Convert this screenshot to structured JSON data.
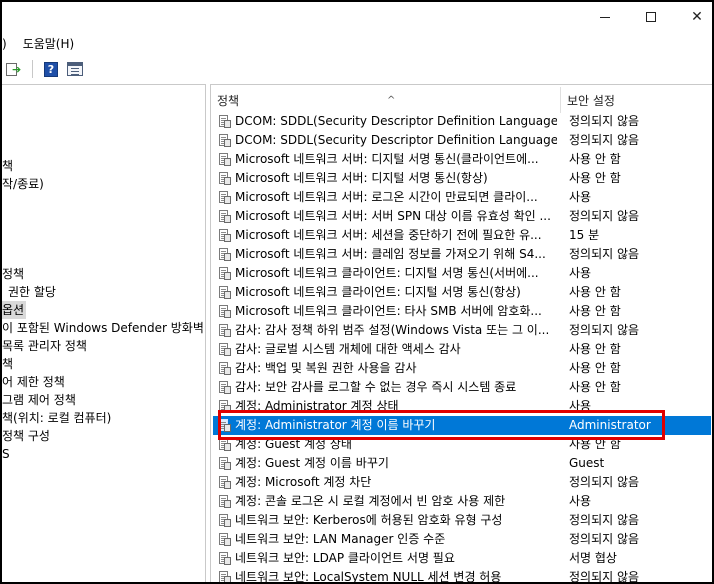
{
  "window": {
    "minimize_glyph": "",
    "close_glyph": "✕"
  },
  "menu": {
    "items": [
      {
        "label": ")"
      },
      {
        "label": "도움말(H)"
      }
    ]
  },
  "toolbar": {
    "buttons": [
      {
        "icon": "export-list-icon"
      },
      {
        "icon": "help-icon",
        "label": "?"
      },
      {
        "icon": "properties-icon"
      }
    ]
  },
  "tree": {
    "items": [
      {
        "label": "책"
      },
      {
        "label": "작/종료)"
      },
      {
        "label": "정책"
      },
      {
        "label": "권한 할당"
      },
      {
        "label": "옵션"
      },
      {
        "label": "이 포함된 Windows Defender 방화벽"
      },
      {
        "label": "목록 관리자 정책"
      },
      {
        "label": "책"
      },
      {
        "label": "어 제한 정책"
      },
      {
        "label": "그램 제어 정책"
      },
      {
        "label": "책(위치: 로컬 컴퓨터)"
      },
      {
        "label": "정책 구성"
      },
      {
        "label": "S"
      }
    ]
  },
  "table": {
    "columns": {
      "policy": "정책",
      "setting": "보안 설정"
    },
    "sort_caret": "^",
    "rows": [
      {
        "policy": "DCOM: SDDL(Security Descriptor Definition Language) 구...",
        "setting": "정의되지 않음"
      },
      {
        "policy": "DCOM: SDDL(Security Descriptor Definition Language) 구...",
        "setting": "정의되지 않음"
      },
      {
        "policy": "Microsoft 네트워크 서버: 디지털 서명 통신(클라이언트에...",
        "setting": "사용 안 함"
      },
      {
        "policy": "Microsoft 네트워크 서버: 디지털 서명 통신(항상)",
        "setting": "사용 안 함"
      },
      {
        "policy": "Microsoft 네트워크 서버: 로그온 시간이 만료되면 클라이...",
        "setting": "사용"
      },
      {
        "policy": "Microsoft 네트워크 서버: 서버 SPN 대상 이름 유효성 확인 ...",
        "setting": "정의되지 않음"
      },
      {
        "policy": "Microsoft 네트워크 서버: 세션을 중단하기 전에 필요한 유...",
        "setting": "15 분"
      },
      {
        "policy": "Microsoft 네트워크 서버: 클레임 정보를 가져오기 위해 S4...",
        "setting": "정의되지 않음"
      },
      {
        "policy": "Microsoft 네트워크 클라이언트: 디지털 서명 통신(서버에...",
        "setting": "사용"
      },
      {
        "policy": "Microsoft 네트워크 클라이언트: 디지털 서명 통신(항상)",
        "setting": "사용 안 함"
      },
      {
        "policy": "Microsoft 네트워크 클라이언트: 타사 SMB 서버에 암호화...",
        "setting": "사용 안 함"
      },
      {
        "policy": "감사: 감사 정책 하위 범주 설정(Windows Vista 또는 그 이...",
        "setting": "정의되지 않음"
      },
      {
        "policy": "감사: 글로벌 시스템 개체에 대한 액세스 감사",
        "setting": "사용 안 함"
      },
      {
        "policy": "감사: 백업 및 복원 권한 사용을 감사",
        "setting": "사용 안 함"
      },
      {
        "policy": "감사: 보안 감사를 로그할 수 없는 경우 즉시 시스템 종료",
        "setting": "사용 안 함"
      },
      {
        "policy": "계정: Administrator 계정 상태",
        "setting": "사용"
      },
      {
        "policy": "계정: Administrator 계정 이름 바꾸기",
        "setting": "Administrator"
      },
      {
        "policy": "계정: Guest 계정 상태",
        "setting": "사용 안 함"
      },
      {
        "policy": "계정: Guest 계정 이름 바꾸기",
        "setting": "Guest"
      },
      {
        "policy": "계정: Microsoft 계정 차단",
        "setting": "정의되지 않음"
      },
      {
        "policy": "계정: 콘솔 로그온 시 로컬 계정에서 빈 암호 사용 제한",
        "setting": "사용"
      },
      {
        "policy": "네트워크 보안: Kerberos에 허용된 암호화 유형 구성",
        "setting": "정의되지 않음"
      },
      {
        "policy": "네트워크 보안: LAN Manager 인증 수준",
        "setting": "정의되지 않음"
      },
      {
        "policy": "네트워크 보안: LDAP 클라이언트 서명 필요",
        "setting": "서명 협상"
      },
      {
        "policy": "네트워크 보안: LocalSystem NULL 세션 변경 허용",
        "setting": "정의되지 않음"
      }
    ],
    "selected_index": 16
  },
  "colors": {
    "selection": "#0078d7",
    "annotation": "#e00000"
  }
}
